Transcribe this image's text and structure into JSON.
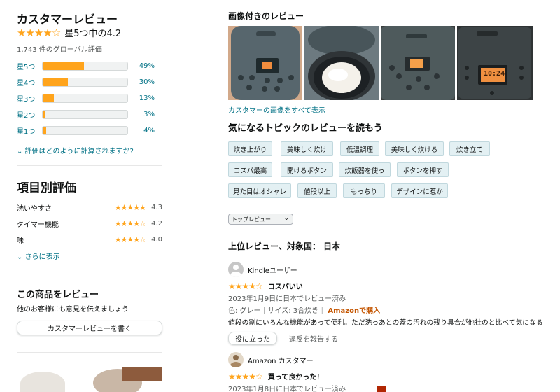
{
  "summary": {
    "title": "カスタマーレビュー",
    "stars": "★★★★☆",
    "rating_text": "星5つ中の4.2",
    "global_count": "1,743 件のグローバル評価",
    "histogram": [
      {
        "label": "星5つ",
        "percent": 49,
        "pct_text": "49%"
      },
      {
        "label": "星4つ",
        "percent": 30,
        "pct_text": "30%"
      },
      {
        "label": "星3つ",
        "percent": 13,
        "pct_text": "13%"
      },
      {
        "label": "星2つ",
        "percent": 3,
        "pct_text": "3%"
      },
      {
        "label": "星1つ",
        "percent": 4,
        "pct_text": "4%"
      }
    ],
    "how_calculated": "⌄ 評価はどのように計算されますか?"
  },
  "features": {
    "title": "項目別評価",
    "items": [
      {
        "name": "洗いやすさ",
        "stars": "★★★★★",
        "value": "4.3"
      },
      {
        "name": "タイマー機能",
        "stars": "★★★★☆",
        "value": "4.2"
      },
      {
        "name": "味",
        "stars": "★★★★☆",
        "value": "4.0"
      }
    ],
    "more": "⌄ さらに表示"
  },
  "write_review": {
    "title": "この商品をレビュー",
    "subtitle": "他のお客様にも意見を伝えましょう",
    "button": "カスタマーレビューを書く"
  },
  "images": {
    "title": "画像付きのレビュー",
    "see_all": "カスタマーの画像をすべて表示",
    "photos": [
      {
        "display": "",
        "icon": "rice-cooker-panel-photo"
      },
      {
        "display": "",
        "icon": "cooked-rice-photo"
      },
      {
        "display": "",
        "icon": "rice-cooker-panel-photo"
      },
      {
        "display": "10:24",
        "icon": "rice-cooker-display-photo"
      }
    ]
  },
  "topics": {
    "title": "気になるトピックのレビューを読もう",
    "chips": [
      "炊き上がり",
      "美味しく炊け",
      "低温調理",
      "美味しく炊ける",
      "炊き立て",
      "コスパ最高",
      "開けるボタン",
      "炊飯器を使っ",
      "ボタンを押す",
      "見た目はオシャレ",
      "値段以上",
      "もっちり",
      "デザインに惹か"
    ]
  },
  "sort": {
    "selected": "トップレビュー",
    "chevron": "⌄"
  },
  "reviews_header": "上位レビュー、対象国： 日本",
  "reviews": [
    {
      "user": "Kindleユーザー",
      "stars": "★★★★☆",
      "title": "コスパいい",
      "date": "2023年1月9日に日本でレビュー済み",
      "meta": "色: グレー｜サイズ: 3合炊き｜",
      "verified": "Amazonで購入",
      "body": "値段の割にいろんな機能があって便利。ただ洗っあとの蓋の汚れの残り具合が他社のと比べて気になる",
      "helpful": "役に立った",
      "report": "違反を報告する"
    },
    {
      "user": "Amazon カスタマー",
      "stars": "★★★★☆",
      "title": "買って良かった！",
      "date": "2023年1月8日に日本でレビュー済み"
    }
  ],
  "colors": {
    "star": "#ffa41c",
    "link": "#007185",
    "chip_bg": "#e3f0f3",
    "verified": "#c45500"
  }
}
